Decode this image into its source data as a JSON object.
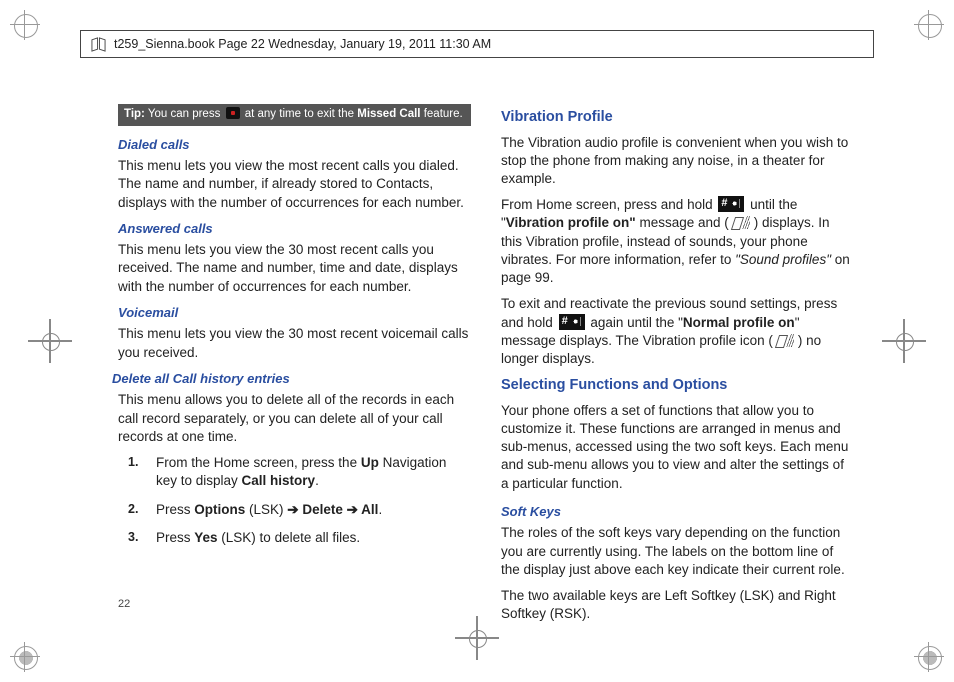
{
  "header": {
    "text": "t259_Sienna.book  Page 22  Wednesday, January 19, 2011  11:30 AM"
  },
  "page_number": "22",
  "left": {
    "tip_prefix": "Tip:",
    "tip_before_icon": " You can press ",
    "tip_after_icon": " at any time to exit the ",
    "tip_bold": "Missed Call",
    "tip_end": " feature.",
    "h_dialed": "Dialed calls",
    "p_dialed": "This menu lets you view the most recent calls you dialed. The name and number, if already stored to Contacts, displays with the number of occurrences for each number.",
    "h_answered": "Answered calls",
    "p_answered": "This menu lets you view the 30 most recent calls you received. The name and number, time and date, displays with the number of occurrences for each number.",
    "h_voicemail": "Voicemail",
    "p_voicemail": "This menu lets you view the 30 most recent voicemail calls you received.",
    "h_delete": "Delete all Call history entries",
    "p_delete": "This menu allows you to delete all of the records in each call record separately, or you can delete all of your call records at one time.",
    "steps": {
      "s1_a": "From the Home screen, press the ",
      "s1_b": "Up",
      "s1_c": " Navigation key to display ",
      "s1_d": "Call history",
      "s1_e": ".",
      "s2_a": "Press ",
      "s2_b": "Options",
      "s2_c": " (LSK) ",
      "s2_arrow1": "➔",
      "s2_d": " Delete ",
      "s2_arrow2": "➔",
      "s2_e": " All",
      "s2_f": ".",
      "s3_a": "Press ",
      "s3_b": "Yes",
      "s3_c": " (LSK) to delete all files."
    }
  },
  "right": {
    "h_vib": "Vibration Profile",
    "p_vib1": "The Vibration audio profile is convenient when you wish to stop the phone from making any noise, in a theater for example.",
    "p_vib2_a": "From Home screen, press and hold ",
    "p_vib2_b": " until the \"",
    "p_vib2_bold1": "Vibration profile on\"",
    "p_vib2_c": " message and (",
    "p_vib2_d": ") displays. In this Vibration profile, instead of sounds, your phone vibrates. For more information, refer to ",
    "p_vib2_ref": "\"Sound profiles\"",
    "p_vib2_e": "  on page 99.",
    "p_vib3_a": "To exit and reactivate the previous sound settings, press and hold ",
    "p_vib3_b": " again until the \"",
    "p_vib3_bold2": "Normal profile on",
    "p_vib3_c": "\" message displays. The Vibration profile icon (",
    "p_vib3_d": ") no longer displays.",
    "h_sel": "Selecting Functions and Options",
    "p_sel": "Your phone offers a set of functions that allow you to customize it. These functions are arranged in menus and sub-menus, accessed using the two soft keys. Each menu and sub-menu allows you to view and alter the settings of a particular function.",
    "h_soft": "Soft Keys",
    "p_soft1": "The roles of the soft keys vary depending on the function you are currently using. The labels on the bottom line of the display just above each key indicate their current role.",
    "p_soft2": "The two available keys are Left Softkey (LSK) and Right Softkey (RSK)."
  }
}
